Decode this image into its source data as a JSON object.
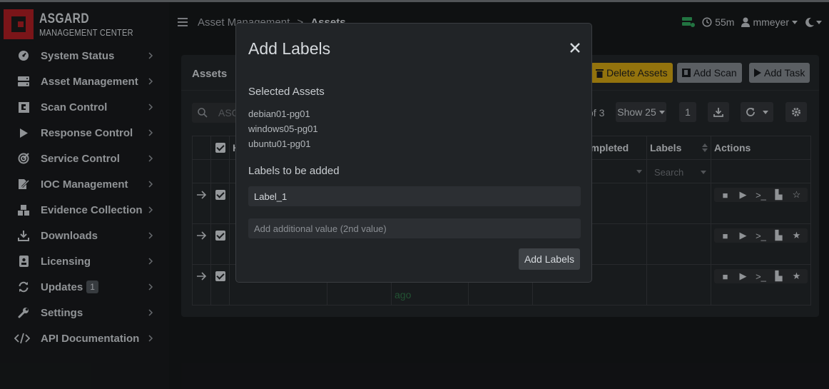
{
  "brand": {
    "line1": "ASGARD",
    "line2": "MANAGEMENT CENTER"
  },
  "header": {
    "breadcrumb_parent": "Asset Management",
    "breadcrumb_sep": ">",
    "breadcrumb_current": "Assets",
    "timer": "55m",
    "user": "mmeyer"
  },
  "sidebar": {
    "items": [
      {
        "label": "System Status",
        "icon": "gauge-icon"
      },
      {
        "label": "Asset Management",
        "icon": "server-icon"
      },
      {
        "label": "Scan Control",
        "icon": "scan-icon"
      },
      {
        "label": "Response Control",
        "icon": "play-icon"
      },
      {
        "label": "Service Control",
        "icon": "target-icon"
      },
      {
        "label": "IOC Management",
        "icon": "file-signature-icon"
      },
      {
        "label": "Evidence Collection",
        "icon": "boxes-icon"
      },
      {
        "label": "Downloads",
        "icon": "download-icon"
      },
      {
        "label": "Licensing",
        "icon": "id-card-icon"
      },
      {
        "label": "Updates",
        "icon": "sync-icon",
        "badge": "1"
      },
      {
        "label": "Settings",
        "icon": "wrench-icon"
      },
      {
        "label": "API Documentation",
        "icon": "code-icon"
      }
    ]
  },
  "card": {
    "title": "Assets",
    "delete_label": "Delete Assets",
    "add_scan_label": "Add Scan",
    "add_task_label": "Add Task",
    "search_placeholder": "ASG",
    "page_info": "of 3",
    "show_label": "Show 25",
    "page_number": "1",
    "col_completed": "ompleted",
    "col_labels": "Labels",
    "col_actions": "Actions",
    "col_h": "H",
    "labels_filter_placeholder": "Search",
    "ago_text": "ago"
  },
  "modal": {
    "title": "Add Labels",
    "selected_heading": "Selected Assets",
    "assets": [
      "debian01-pg01",
      "windows05-pg01",
      "ubuntu01-pg01"
    ],
    "labels_heading": "Labels to be added",
    "label_value": "Label_1",
    "second_placeholder": "Add additional value (2nd value)",
    "submit_label": "Add Labels"
  },
  "colors": {
    "accent_red": "#a51d22",
    "warning_yellow": "#c49a12",
    "status_green": "#2e9b57"
  }
}
